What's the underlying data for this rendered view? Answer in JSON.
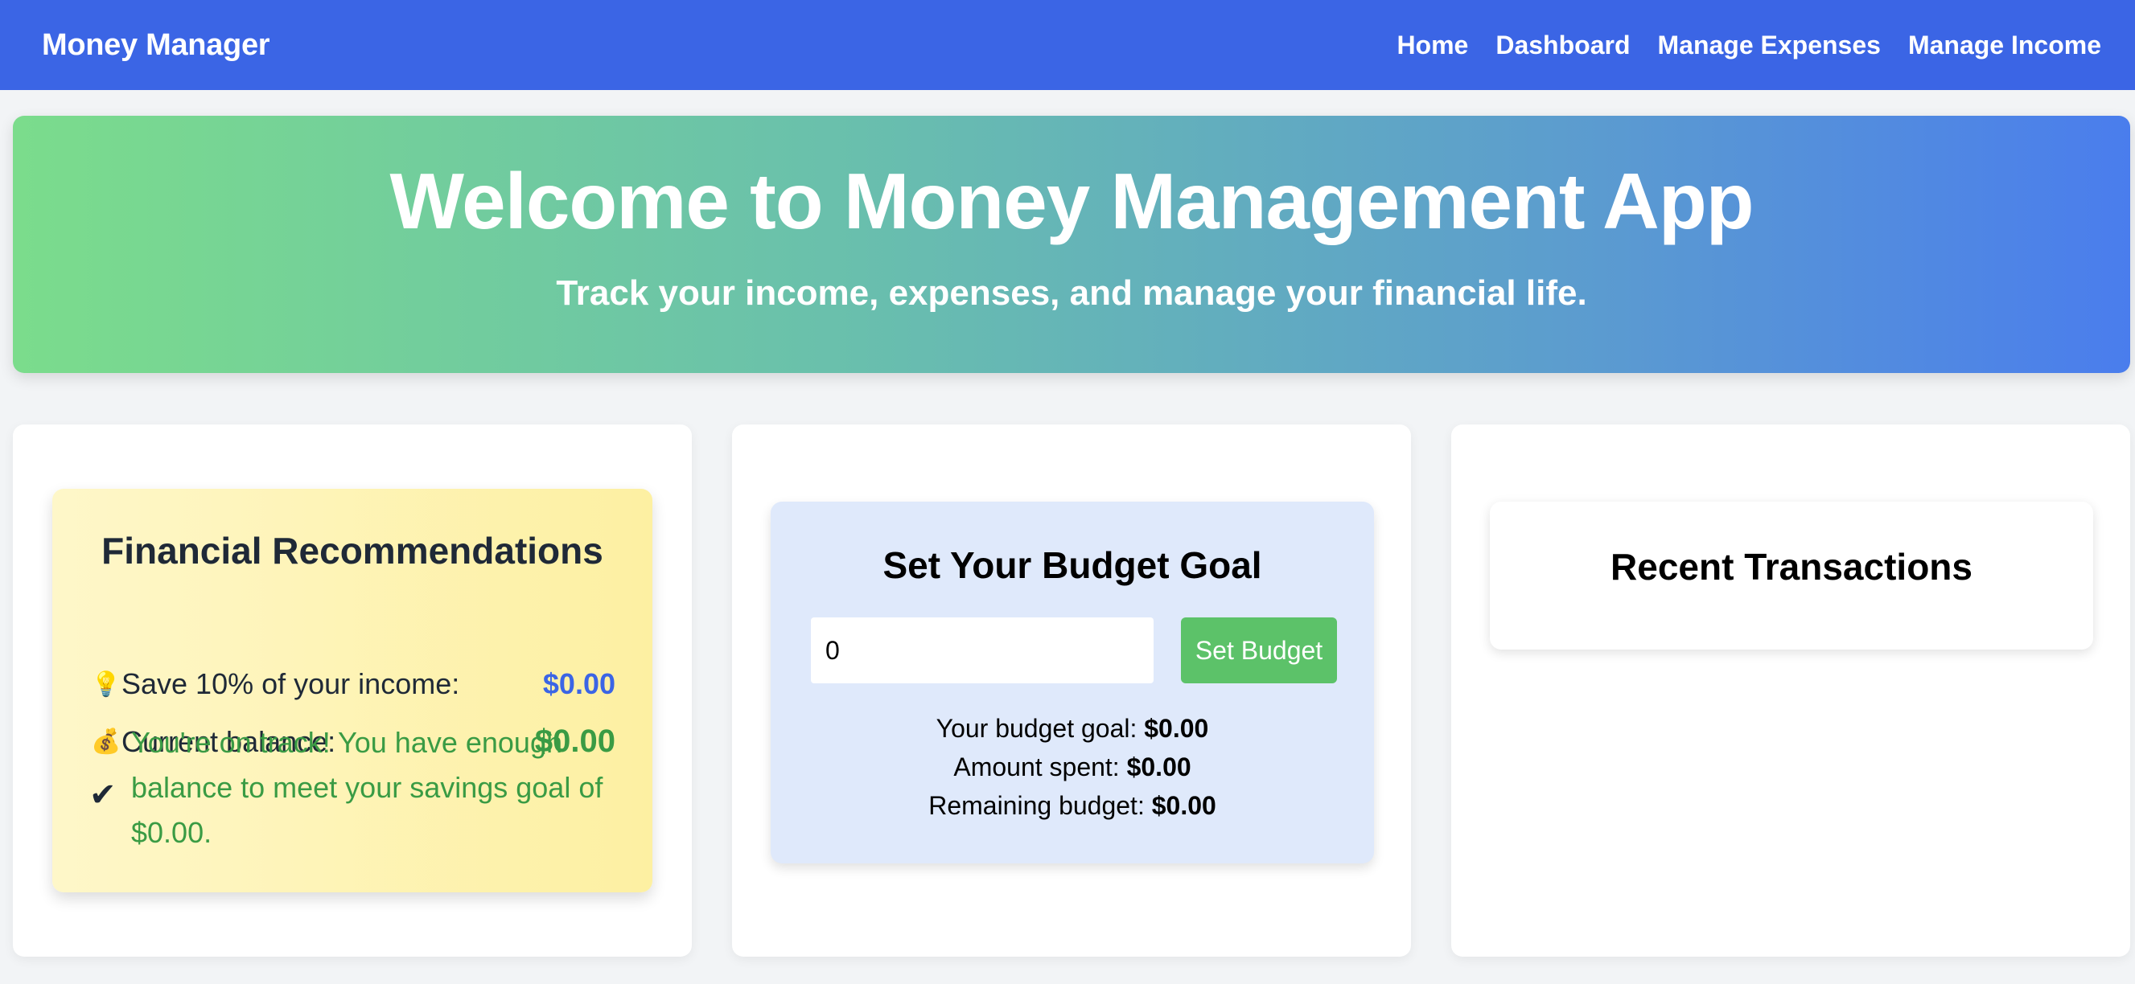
{
  "nav": {
    "brand": "Money Manager",
    "links": [
      "Home",
      "Dashboard",
      "Manage Expenses",
      "Manage Income"
    ]
  },
  "hero": {
    "title": "Welcome to Money Management App",
    "subtitle": "Track your income, expenses, and manage your financial life."
  },
  "recommendations": {
    "title": "Financial Recommendations",
    "save_icon": "lightbulb-icon",
    "save_label": "Save 10% of your income:",
    "save_value": "$0.00",
    "balance_icon": "money-bag-icon",
    "balance_label": "Current balance:",
    "balance_value": "$0.00",
    "status_icon": "checkmark-icon",
    "status_message": "You're on track! You have enough balance to meet your savings goal of $0.00."
  },
  "budget": {
    "title": "Set Your Budget Goal",
    "input_value": "0",
    "button_label": "Set Budget",
    "goal_label": "Your budget goal:",
    "goal_value": "$0.00",
    "spent_label": "Amount spent:",
    "spent_value": "$0.00",
    "remaining_label": "Remaining budget:",
    "remaining_value": "$0.00"
  },
  "transactions": {
    "title": "Recent Transactions"
  },
  "colors": {
    "nav_bg": "#3b65e5",
    "accent_blue": "#3b65e5",
    "accent_green": "#3a9b44",
    "button_green": "#5cc269"
  }
}
